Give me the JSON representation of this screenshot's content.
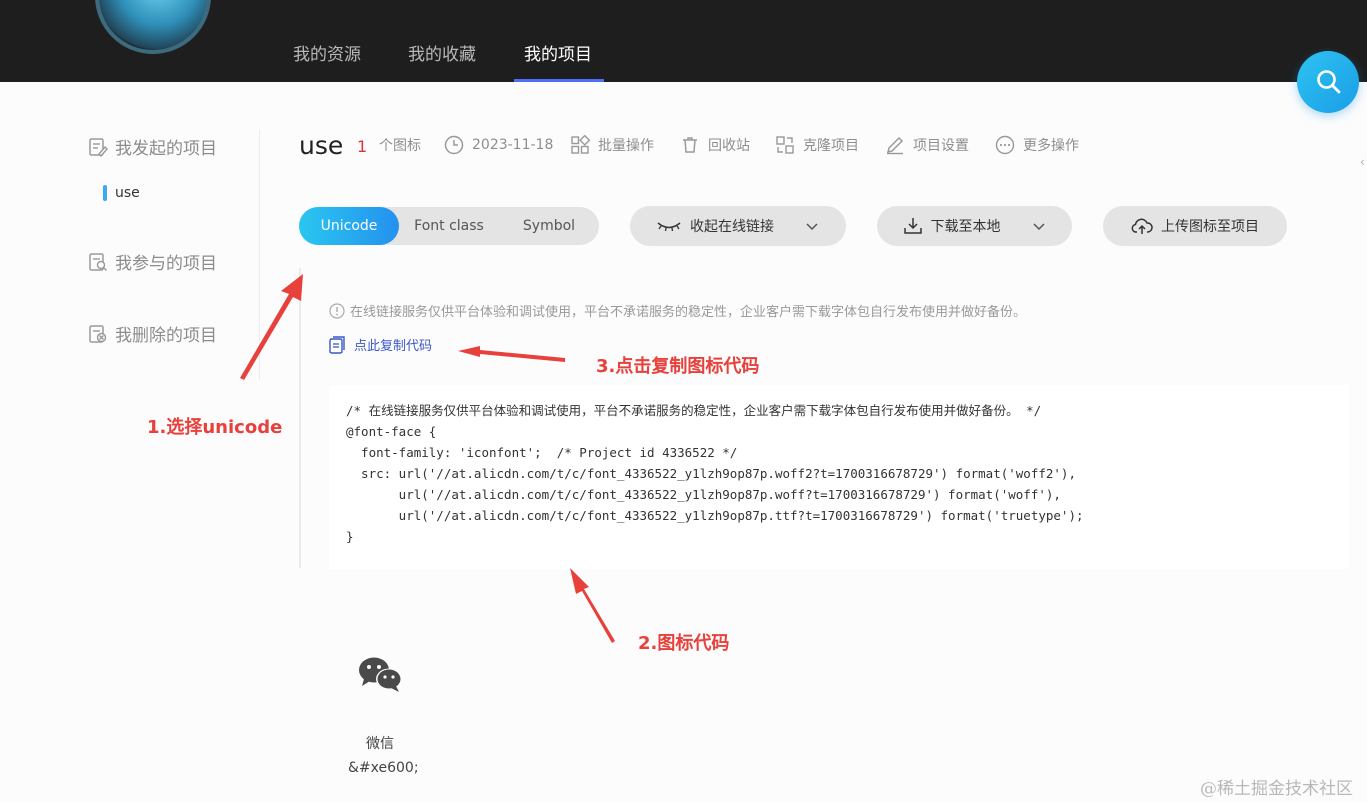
{
  "header": {
    "tabs": [
      {
        "label": "我的资源",
        "active": false
      },
      {
        "label": "我的收藏",
        "active": false
      },
      {
        "label": "我的项目",
        "active": true
      }
    ]
  },
  "sidebar": {
    "started": "我发起的项目",
    "started_sub": "use",
    "joined": "我参与的项目",
    "deleted": "我删除的项目"
  },
  "project": {
    "name": "use",
    "icon_count": "1",
    "icon_count_unit": "个图标",
    "date": "2023-11-18",
    "tools": {
      "batch": "批量操作",
      "recycle": "回收站",
      "clone": "克隆项目",
      "settings": "项目设置",
      "more": "更多操作"
    }
  },
  "format_tabs": {
    "unicode": "Unicode",
    "font_class": "Font class",
    "symbol": "Symbol",
    "selected": "Unicode"
  },
  "actions": {
    "collapse_link": "收起在线链接",
    "download": "下载至本地",
    "upload": "上传图标至项目"
  },
  "notice": "在线链接服务仅供平台体验和调试使用，平台不承诺服务的稳定性，企业客户需下载字体包自行发布使用并做好备份。",
  "copy_code_label": "点此复制代码",
  "code_lines": [
    "/* 在线链接服务仅供平台体验和调试使用，平台不承诺服务的稳定性，企业客户需下载字体包自行发布使用并做好备份。 */",
    "@font-face {",
    "  font-family: 'iconfont';  /* Project id 4336522 */",
    "  src: url('//at.alicdn.com/t/c/font_4336522_y1lzh9op87p.woff2?t=1700316678729') format('woff2'),",
    "       url('//at.alicdn.com/t/c/font_4336522_y1lzh9op87p.woff?t=1700316678729') format('woff'),",
    "       url('//at.alicdn.com/t/c/font_4336522_y1lzh9op87p.ttf?t=1700316678729') format('truetype');",
    "}"
  ],
  "annotations": {
    "a1": "1.选择unicode",
    "a2": "2.图标代码",
    "a3": "3.点击复制图标代码"
  },
  "icons": [
    {
      "name": "微信",
      "code": "&#xe600;",
      "icon": "wechat-icon"
    }
  ],
  "watermark": "@稀土掘金技术社区",
  "colors": {
    "accent": "#2491ee",
    "annotation": "#e8403a",
    "count": "#e0303a"
  }
}
